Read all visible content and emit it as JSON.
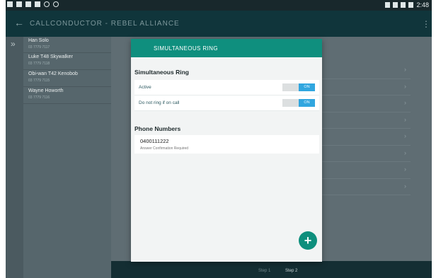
{
  "status_bar": {
    "time": "2:48"
  },
  "app_bar": {
    "title": "CALLCONDUCTOR  -  REBEL ALLIANCE",
    "back_icon": "arrow-left-icon",
    "more_icon": "more-icon"
  },
  "contacts": [
    {
      "name": "Han Solo",
      "number": "03 7779 7117"
    },
    {
      "name": "Luke T48 Skywalker",
      "number": "03 7779 7118"
    },
    {
      "name": "Obi-wan T42 Kenobob",
      "number": "03 7779 7115"
    },
    {
      "name": "Wayne Howorth",
      "number": "03 7779 7116"
    }
  ],
  "steps": {
    "step1": "Step 1",
    "step2": "Step 2"
  },
  "modal": {
    "title": "SIMULTANEOUS RING",
    "section_title": "Simultaneous Ring",
    "settings": [
      {
        "label": "Active",
        "toggle": "ON"
      },
      {
        "label": "Do not ring if on call",
        "toggle": "ON"
      }
    ],
    "phone_section_title": "Phone Numbers",
    "phone_number": "0400111222",
    "phone_note": "Answer Confirmation Required",
    "add_icon": "+"
  },
  "colors": {
    "accent": "#0f8f7e",
    "toggle_on": "#31a6df",
    "app_bar": "#10353b"
  }
}
